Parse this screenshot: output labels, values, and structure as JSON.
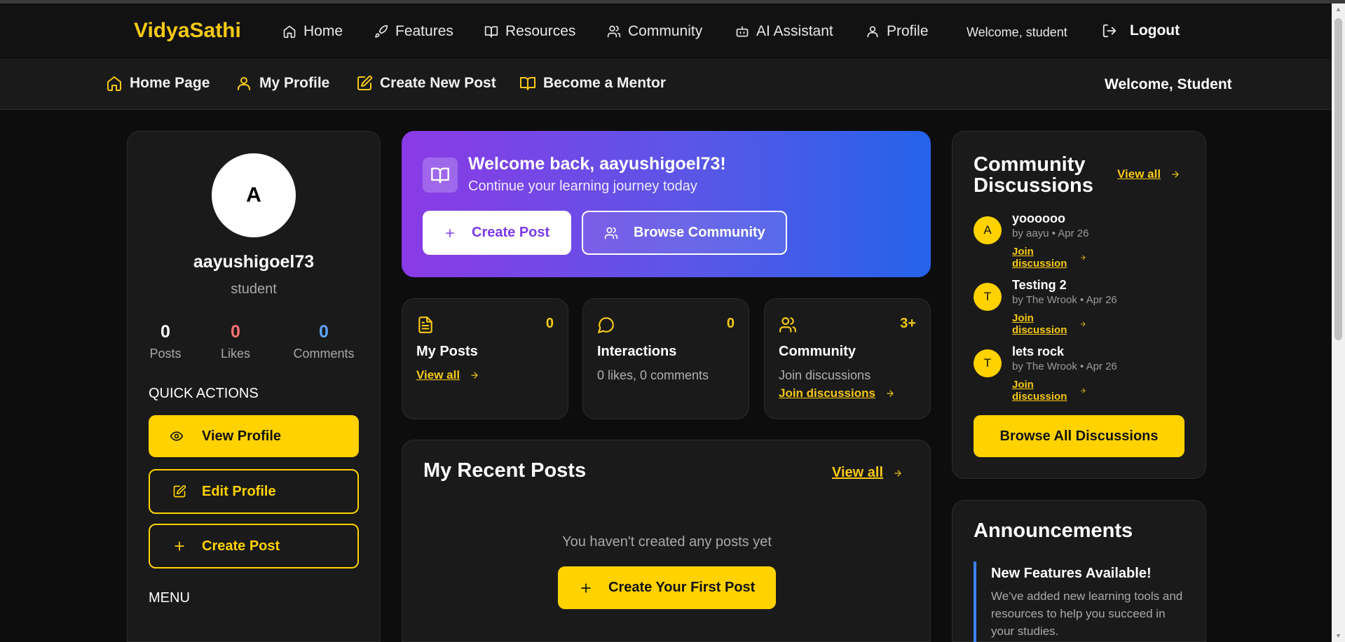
{
  "topnav": {
    "brand": "VidyaSathi",
    "items": [
      {
        "label": "Home",
        "icon": "home-icon"
      },
      {
        "label": "Features",
        "icon": "rocket-icon"
      },
      {
        "label": "Resources",
        "icon": "book-icon"
      },
      {
        "label": "Community",
        "icon": "users-icon"
      },
      {
        "label": "AI Assistant",
        "icon": "bot-icon"
      },
      {
        "label": "Profile",
        "icon": "user-icon"
      }
    ],
    "welcome": "Welcome, student",
    "logout": "Logout"
  },
  "subnav": {
    "items": [
      {
        "label": "Home Page",
        "icon": "home-icon"
      },
      {
        "label": "My Profile",
        "icon": "user-icon"
      },
      {
        "label": "Create New Post",
        "icon": "edit-icon"
      },
      {
        "label": "Become a Mentor",
        "icon": "book-icon"
      }
    ],
    "welcome": "Welcome, Student"
  },
  "profile": {
    "avatar_letter": "A",
    "username": "aayushigoel73",
    "role": "student",
    "stats": [
      {
        "value": "0",
        "label": "Posts",
        "color": "#ffffff"
      },
      {
        "value": "0",
        "label": "Likes",
        "color": "#f87171"
      },
      {
        "value": "0",
        "label": "Comments",
        "color": "#60a5fa"
      }
    ],
    "quick_actions_title": "QUICK ACTIONS",
    "view_profile": "View Profile",
    "edit_profile": "Edit Profile",
    "create_post": "Create Post",
    "menu_title": "MENU"
  },
  "welcome_banner": {
    "title": "Welcome back, aayushigoel73!",
    "subtitle": "Continue your learning journey today",
    "create_post": "Create Post",
    "browse_community": "Browse Community"
  },
  "stat_cards": [
    {
      "title": "My Posts",
      "count": "0",
      "link": "View all"
    },
    {
      "title": "Interactions",
      "count": "0",
      "subtitle": "0 likes, 0 comments"
    },
    {
      "title": "Community",
      "count": "3+",
      "subtitle": "Join discussions",
      "link": "Join discussions"
    }
  ],
  "recent_posts": {
    "title": "My Recent Posts",
    "view_all": "View all",
    "empty_text": "You haven't created any posts yet",
    "create_first": "Create Your First Post"
  },
  "community": {
    "title": "Community Discussions",
    "view_all": "View all",
    "discussions": [
      {
        "avatar": "A",
        "title": "yoooooo",
        "meta": "by aayu • Apr 26",
        "link": "Join discussion"
      },
      {
        "avatar": "T",
        "title": "Testing 2",
        "meta": "by The Wrook • Apr 26",
        "link": "Join discussion"
      },
      {
        "avatar": "T",
        "title": "lets rock",
        "meta": "by The Wrook • Apr 26",
        "link": "Join discussion"
      }
    ],
    "browse_all": "Browse All Discussions"
  },
  "announcements": {
    "title": "Announcements",
    "item_title": "New Features Available!",
    "item_body": "We've added new learning tools and resources to help you succeed in your studies."
  },
  "colors": {
    "accent": "#ffd200",
    "background": "#0d0d0d",
    "card": "#1a1a1a",
    "gradient_start": "#8b3ae6",
    "gradient_end": "#2563eb"
  }
}
